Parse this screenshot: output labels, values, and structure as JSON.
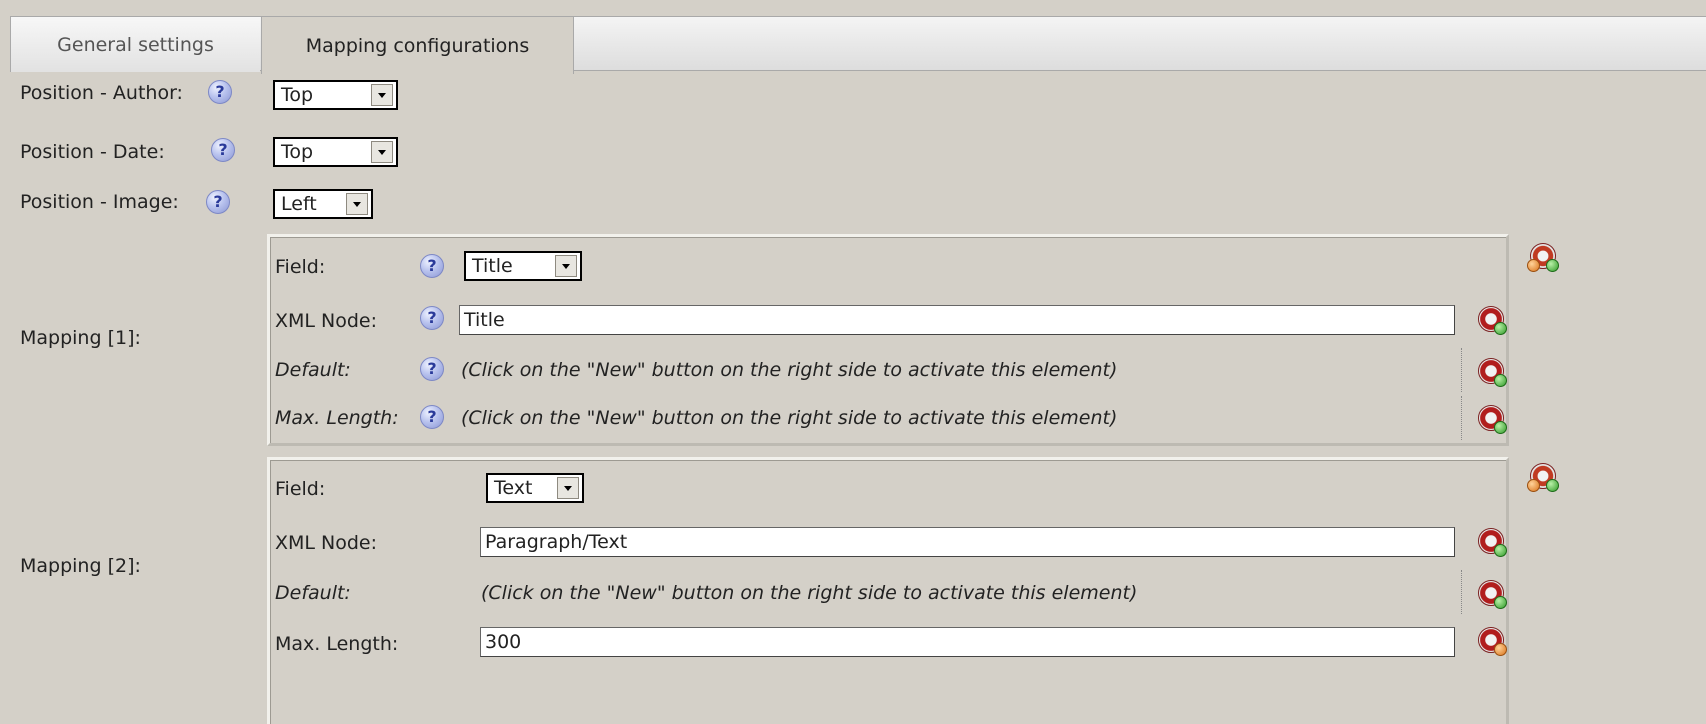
{
  "tabs": [
    {
      "label": "General settings",
      "active": false
    },
    {
      "label": "Mapping configurations",
      "active": true
    }
  ],
  "positions": {
    "author": {
      "label": "Position - Author:",
      "value": "Top"
    },
    "date": {
      "label": "Position - Date:",
      "value": "Top"
    },
    "image": {
      "label": "Position - Image:",
      "value": "Left"
    }
  },
  "help_glyph": "?",
  "mapping1": {
    "label": "Mapping [1]:",
    "field_label": "Field:",
    "field_value": "Title",
    "xml_label": "XML Node:",
    "xml_value": "Title",
    "default_label": "Default:",
    "default_note": "(Click on the \"New\" button on the right side to activate this element)",
    "maxlen_label": "Max. Length:",
    "maxlen_note": "(Click on the \"New\" button on the right side to activate this element)"
  },
  "mapping2": {
    "label": "Mapping [2]:",
    "field_label": "Field:",
    "field_value": "Text",
    "xml_label": "XML Node:",
    "xml_value": "Paragraph/Text",
    "default_label": "Default:",
    "default_note": "(Click on the \"New\" button on the right side to activate this element)",
    "maxlen_label": "Max. Length:",
    "maxlen_value": "300"
  },
  "icons": {
    "help": "help-icon",
    "new": "new-element-icon",
    "mapping": "mapping-options-icon"
  }
}
